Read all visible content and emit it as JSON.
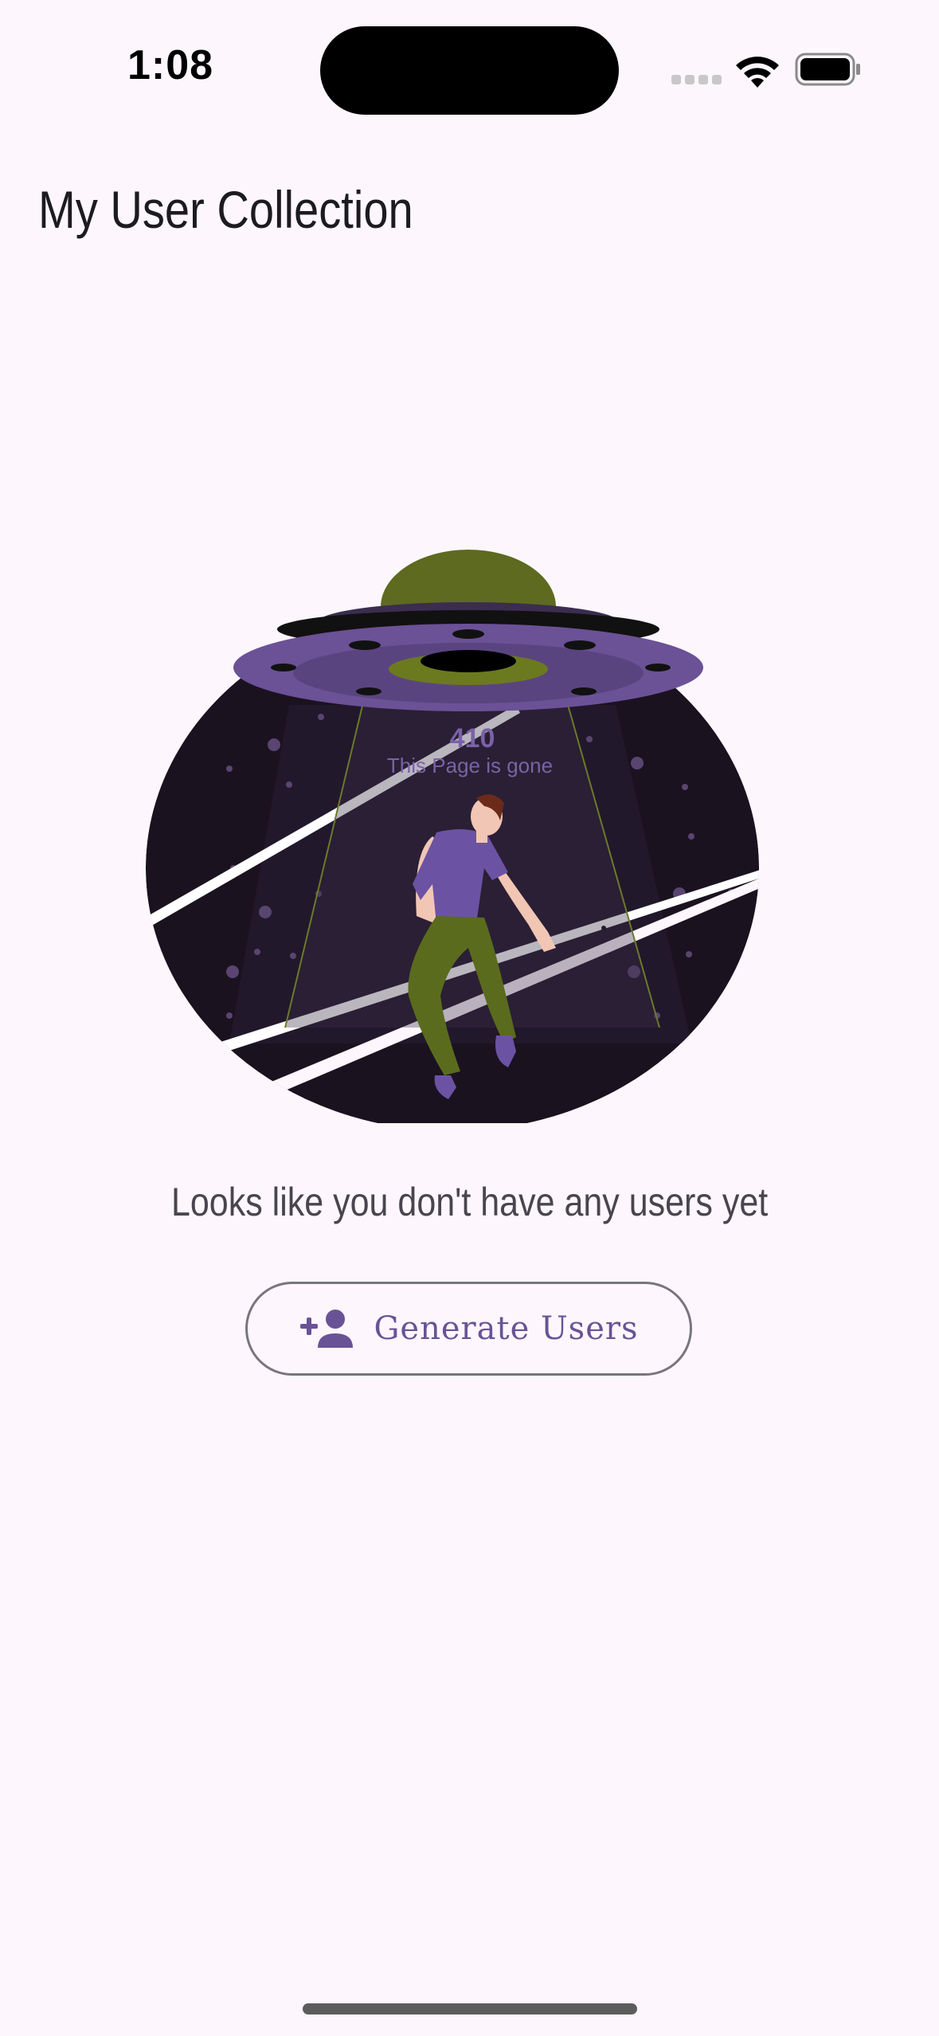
{
  "status_bar": {
    "time": "1:08",
    "icons": [
      "signal-icon",
      "wifi-icon",
      "battery-icon"
    ]
  },
  "header": {
    "title": "My User Collection"
  },
  "illustration": {
    "code": "410",
    "caption": "This Page is gone",
    "description_icon": "ufo-abduction-illustration"
  },
  "empty_state": {
    "message": "Looks like you don't have any users yet"
  },
  "actions": {
    "generate_button": {
      "label": "Generate Users",
      "icon": "person-add-icon"
    }
  },
  "colors": {
    "background": "#fdf7fd",
    "accent": "#6a5296",
    "outline": "#79747e",
    "text": "#1c1b1f"
  }
}
